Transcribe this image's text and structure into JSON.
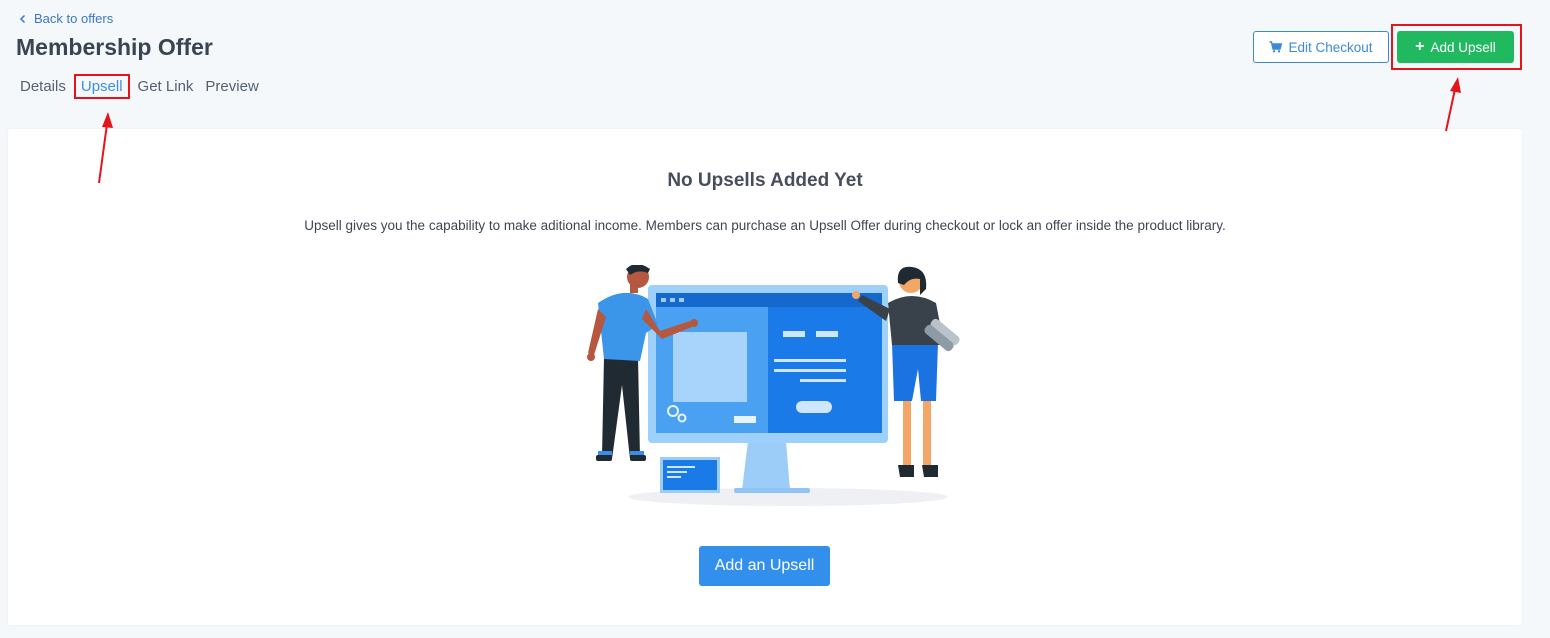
{
  "header": {
    "back_link": "Back to offers",
    "title": "Membership Offer",
    "tabs": [
      {
        "label": "Details",
        "active": false
      },
      {
        "label": "Upsell",
        "active": true
      },
      {
        "label": "Get Link",
        "active": false
      },
      {
        "label": "Preview",
        "active": false
      }
    ],
    "edit_checkout_label": "Edit Checkout",
    "add_upsell_label": "Add Upsell"
  },
  "empty_state": {
    "title": "No Upsells Added Yet",
    "description": "Upsell gives you the capability to make aditional income. Members can purchase an Upsell Offer during checkout or lock an offer inside the product library.",
    "button_label": "Add an Upsell"
  },
  "icons": {
    "back": "chevron-left-icon",
    "cart": "cart-icon",
    "plus": "plus-icon"
  },
  "colors": {
    "accent_blue": "#3290ec",
    "success_green": "#20b960",
    "annotation_red": "#e3141b"
  }
}
